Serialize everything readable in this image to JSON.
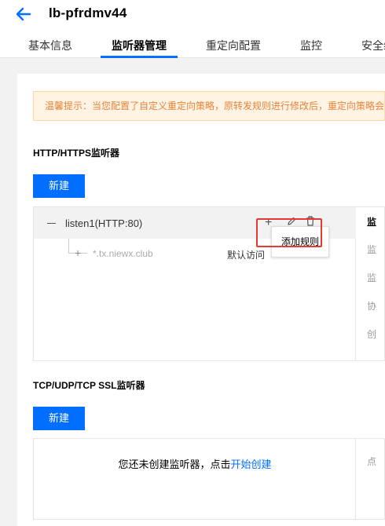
{
  "header": {
    "title": "lb-pfrdmv44",
    "tabs": [
      "基本信息",
      "监听器管理",
      "重定向配置",
      "监控",
      "安全组"
    ]
  },
  "tip": {
    "text": "温馨提示：当您配置了自定义重定向策略，原转发规则进行修改后，重定向策略会"
  },
  "http_section": {
    "title": "HTTP/HTTPS监听器",
    "new_button": "新建",
    "listener": {
      "name": "listen1(HTTP:80)",
      "domain": "*.tx.niewx.club",
      "default_access": "默认访问",
      "tooltip": "添加规则"
    },
    "side_labels": [
      "监",
      "监",
      "监",
      "协",
      "创"
    ]
  },
  "tcp_section": {
    "title": "TCP/UDP/TCP SSL监听器",
    "new_button": "新建",
    "empty_text": "您还未创建监听器，点击",
    "create_link": "开始创建",
    "side_label": "点"
  },
  "colors": {
    "accent": "#006eff",
    "tip_bg": "#fff4e3",
    "tip_text": "#e5843a",
    "highlight": "#e53935"
  }
}
